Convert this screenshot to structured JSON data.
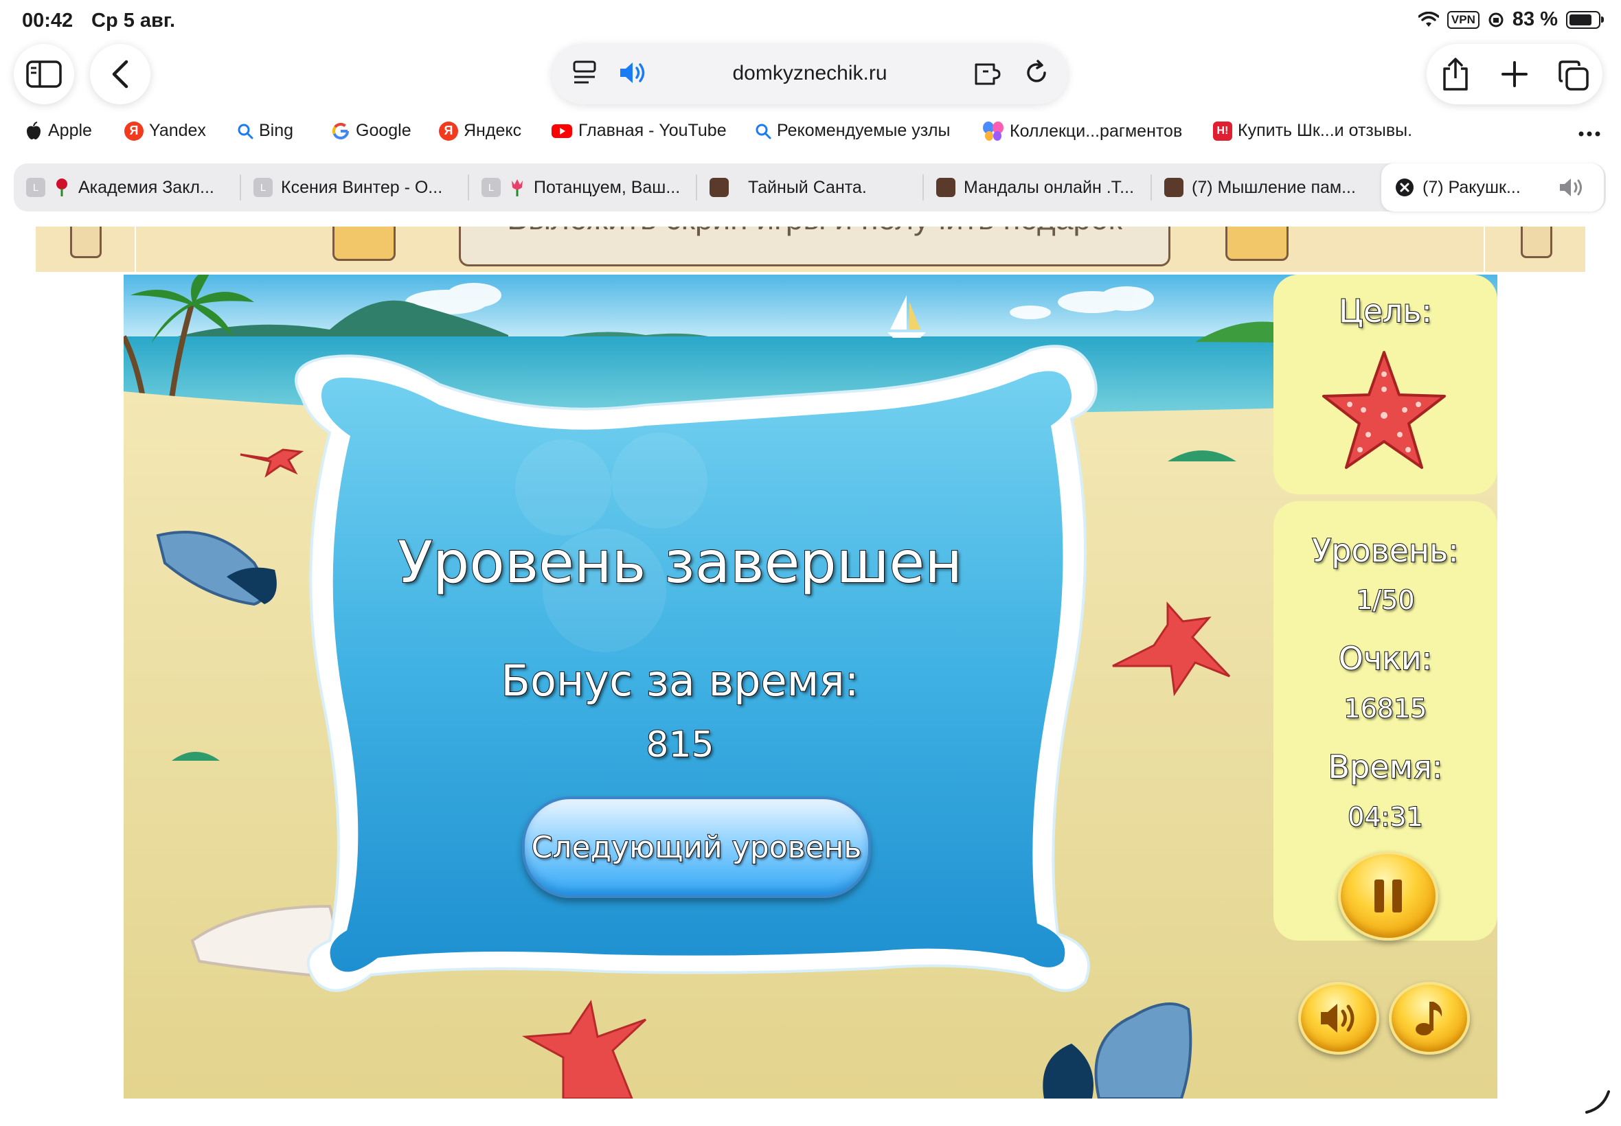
{
  "status_bar": {
    "time": "00:42",
    "date": "Ср 5 авг.",
    "vpn": "VPN",
    "battery": "83 %"
  },
  "toolbar": {
    "url": "domkyznechik.ru"
  },
  "bookmarks": [
    {
      "label": "Apple",
      "icon": "apple-icon"
    },
    {
      "label": "Yandex",
      "icon": "yandex-icon"
    },
    {
      "label": "Bing",
      "icon": "search-icon"
    },
    {
      "label": "Google",
      "icon": "google-icon"
    },
    {
      "label": "Яндекс",
      "icon": "yandex-icon"
    },
    {
      "label": "Главная - YouTube",
      "icon": "youtube-icon"
    },
    {
      "label": "Рекомендуемые узлы",
      "icon": "search-icon"
    },
    {
      "label": "Коллекци...рагментов",
      "icon": "butterfly-icon"
    },
    {
      "label": "Купить Шк...и отзывы.",
      "icon": "store-icon"
    }
  ],
  "tabs": [
    {
      "label": "Академия Закл...",
      "icon": "rose-icon"
    },
    {
      "label": "Ксения Винтер - О...",
      "icon": "site-icon"
    },
    {
      "label": "Потанцуем, Ваш...",
      "icon": "tulip-icon"
    },
    {
      "label": "Тайный Санта.",
      "icon": "site-icon"
    },
    {
      "label": "Мандалы онлайн .Т...",
      "icon": "site-icon"
    },
    {
      "label": "(7) Мышление пам...",
      "icon": "site-icon"
    },
    {
      "label": "(7) Ракушк...",
      "icon": "close-icon"
    }
  ],
  "site_strip": {
    "banner": "Выложить скрин игры и получить подарок"
  },
  "game": {
    "dialog": {
      "title": "Уровень завершен",
      "bonus_label": "Бонус за время:",
      "bonus_value": "815",
      "next_button": "Следующий уровень"
    },
    "sidebar": {
      "goal_label": "Цель:",
      "level_label": "Уровень:",
      "level_value": "1/50",
      "score_label": "Очки:",
      "score_value": "16815",
      "time_label": "Время:",
      "time_value": "04:31"
    },
    "colors": {
      "panel": "#f6f6a6",
      "dialog_blue": "#3fb1e3",
      "button_gold": "#ffd23a",
      "starfish": "#e84a4a"
    }
  }
}
